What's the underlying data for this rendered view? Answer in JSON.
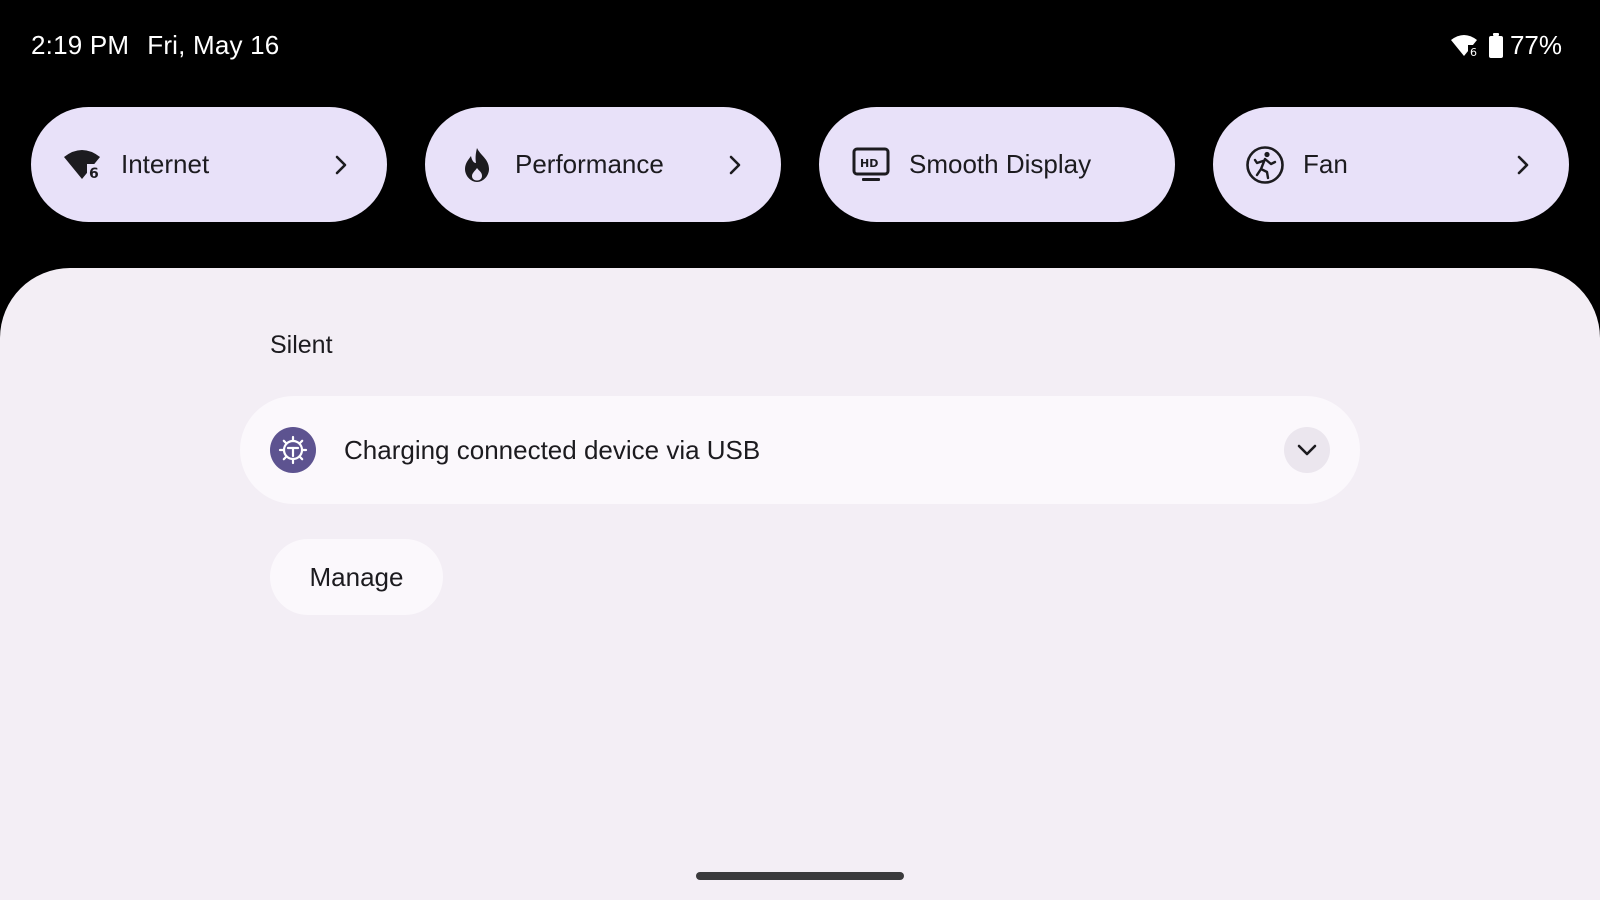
{
  "status_bar": {
    "time": "2:19 PM",
    "date": "Fri, May 16",
    "wifi_icon": "wifi-6-icon",
    "battery_icon": "battery-icon",
    "battery_percent": "77%"
  },
  "quick_tiles": [
    {
      "label": "Internet",
      "icon": "wifi-6-icon",
      "has_chevron": true
    },
    {
      "label": "Performance",
      "icon": "flame-icon",
      "has_chevron": true
    },
    {
      "label": "Smooth Display",
      "icon": "hd-display-icon",
      "has_chevron": false
    },
    {
      "label": "Fan",
      "icon": "fan-runner-icon",
      "has_chevron": true
    }
  ],
  "notifications": {
    "section_title": "Silent",
    "items": [
      {
        "icon": "settings-gear-icon",
        "text": "Charging connected device via USB",
        "expand_icon": "chevron-down-icon"
      }
    ],
    "manage_label": "Manage"
  },
  "colors": {
    "background": "#000000",
    "tile_bg": "#e8e1f9",
    "shade_bg": "#f3eef5",
    "card_bg": "#fbf8fc",
    "notif_icon_bg": "#5d5390",
    "text_dark": "#1c1b1f"
  }
}
